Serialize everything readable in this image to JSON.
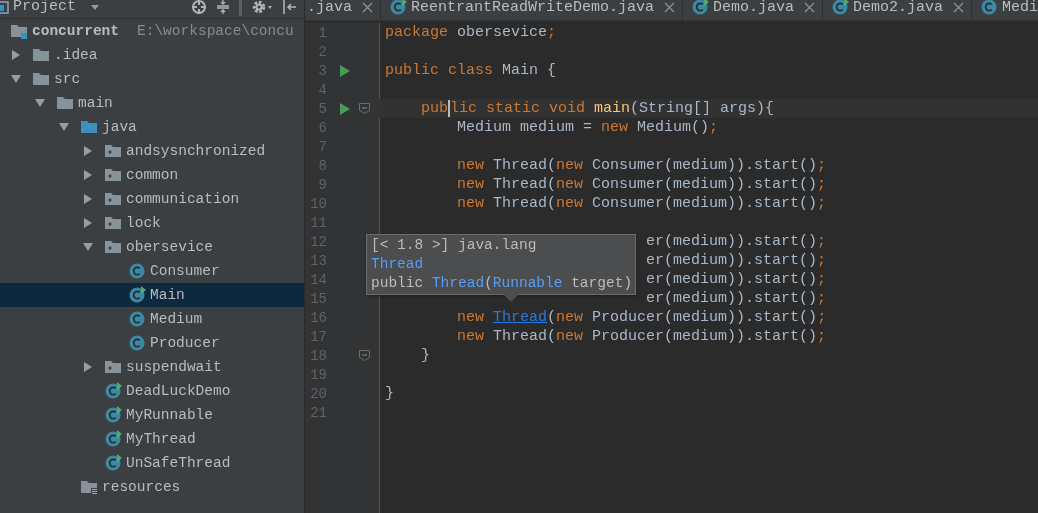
{
  "project_panel": {
    "title": "Project",
    "tree": [
      {
        "name": "concurrent",
        "path": "E:\\workspace\\concu",
        "kind": "module",
        "selected": false,
        "children": [
          {
            "name": ".idea",
            "kind": "folder",
            "expanded": false,
            "selected": false
          },
          {
            "name": "src",
            "kind": "folder",
            "expanded": true,
            "selected": false,
            "children": [
              {
                "name": "main",
                "kind": "folder",
                "expanded": true,
                "selected": false,
                "children": [
                  {
                    "name": "java",
                    "kind": "source-root",
                    "expanded": true,
                    "selected": false,
                    "children": [
                      {
                        "name": "andsysnchronized",
                        "kind": "package",
                        "expanded": false,
                        "selected": false
                      },
                      {
                        "name": "common",
                        "kind": "package",
                        "expanded": false,
                        "selected": false
                      },
                      {
                        "name": "communication",
                        "kind": "package",
                        "expanded": false,
                        "selected": false
                      },
                      {
                        "name": "lock",
                        "kind": "package",
                        "expanded": false,
                        "selected": false
                      },
                      {
                        "name": "obersevice",
                        "kind": "package",
                        "expanded": true,
                        "selected": false,
                        "children": [
                          {
                            "name": "Consumer",
                            "kind": "class",
                            "selected": false
                          },
                          {
                            "name": "Main",
                            "kind": "main-class",
                            "selected": true
                          },
                          {
                            "name": "Medium",
                            "kind": "class",
                            "selected": false
                          },
                          {
                            "name": "Producer",
                            "kind": "class",
                            "selected": false
                          }
                        ]
                      },
                      {
                        "name": "suspendwait",
                        "kind": "package",
                        "expanded": false,
                        "selected": false
                      },
                      {
                        "name": "DeadLuckDemo",
                        "kind": "main-class",
                        "selected": false
                      },
                      {
                        "name": "MyRunnable",
                        "kind": "main-class",
                        "selected": false
                      },
                      {
                        "name": "MyThread",
                        "kind": "main-class",
                        "selected": false
                      },
                      {
                        "name": "UnSafeThread",
                        "kind": "main-class",
                        "selected": false
                      }
                    ]
                  },
                  {
                    "name": "resources",
                    "kind": "resources",
                    "selected": false
                  }
                ]
              }
            ]
          }
        ]
      }
    ]
  },
  "tabs": [
    {
      "label": ".java",
      "selected": false
    },
    {
      "label": "ReentrantReadWriteDemo.java",
      "kind": "main-class",
      "selected": false
    },
    {
      "label": "Demo.java",
      "kind": "main-class",
      "selected": false
    },
    {
      "label": "Demo2.java",
      "kind": "main-class",
      "selected": false
    },
    {
      "label": "Medi",
      "kind": "class",
      "selected": false
    }
  ],
  "editor": {
    "lines": [
      {
        "number": "1",
        "tokens": [
          {
            "text": "package",
            "kind": "keyword"
          },
          {
            "text": " obersevice",
            "kind": "plain"
          },
          {
            "text": ";",
            "kind": "keyword"
          }
        ]
      },
      {
        "number": "2"
      },
      {
        "number": "3",
        "runnable": true,
        "tokens": [
          {
            "text": "public class",
            "kind": "keyword"
          },
          {
            "text": " Main {",
            "kind": "plain"
          }
        ]
      },
      {
        "number": "4"
      },
      {
        "number": "5",
        "runnable": true,
        "fold": true,
        "current": true,
        "tokens": [
          {
            "text": "    pub",
            "kind": "keyword"
          },
          {
            "kind": "caret"
          },
          {
            "text": "lic static void",
            "kind": "keyword"
          },
          {
            "text": " main",
            "kind": "method"
          },
          {
            "text": "(String[] args){",
            "kind": "plain"
          }
        ]
      },
      {
        "number": "6",
        "tokens": [
          {
            "text": "        Medium medium = ",
            "kind": "plain"
          },
          {
            "text": "new",
            "kind": "keyword"
          },
          {
            "text": " Medium()",
            "kind": "plain"
          },
          {
            "text": ";",
            "kind": "keyword"
          }
        ]
      },
      {
        "number": "7"
      },
      {
        "number": "8",
        "tokens": [
          {
            "text": "        new",
            "kind": "keyword"
          },
          {
            "text": " Thread(",
            "kind": "plain"
          },
          {
            "text": "new",
            "kind": "keyword"
          },
          {
            "text": " Consumer(medium)).start()",
            "kind": "plain"
          },
          {
            "text": ";",
            "kind": "keyword"
          }
        ]
      },
      {
        "number": "9",
        "tokens": [
          {
            "text": "        new",
            "kind": "keyword"
          },
          {
            "text": " Thread(",
            "kind": "plain"
          },
          {
            "text": "new",
            "kind": "keyword"
          },
          {
            "text": " Consumer(medium)).start()",
            "kind": "plain"
          },
          {
            "text": ";",
            "kind": "keyword"
          }
        ]
      },
      {
        "number": "10",
        "tokens": [
          {
            "text": "        new",
            "kind": "keyword"
          },
          {
            "text": " Thread(",
            "kind": "plain"
          },
          {
            "text": "new",
            "kind": "keyword"
          },
          {
            "text": " Consumer(medium)).start()",
            "kind": "plain"
          },
          {
            "text": ";",
            "kind": "keyword"
          }
        ]
      },
      {
        "number": "11"
      },
      {
        "number": "12",
        "covered": true,
        "tokens": [
          {
            "text": "er(medium)).start()",
            "kind": "plain"
          },
          {
            "text": ";",
            "kind": "keyword"
          }
        ]
      },
      {
        "number": "13",
        "covered": true,
        "tokens": [
          {
            "text": "er(medium)).start()",
            "kind": "plain"
          },
          {
            "text": ";",
            "kind": "keyword"
          }
        ]
      },
      {
        "number": "14",
        "covered": true,
        "tokens": [
          {
            "text": "er(medium)).start()",
            "kind": "plain"
          },
          {
            "text": ";",
            "kind": "keyword"
          }
        ]
      },
      {
        "number": "15",
        "covered": true,
        "tokens": [
          {
            "text": "er(medium)).start()",
            "kind": "plain"
          },
          {
            "text": ";",
            "kind": "keyword"
          }
        ]
      },
      {
        "number": "16",
        "tokens": [
          {
            "text": "        new ",
            "kind": "keyword"
          },
          {
            "text": "Thread",
            "kind": "link"
          },
          {
            "text": "(",
            "kind": "plain"
          },
          {
            "text": "new",
            "kind": "keyword"
          },
          {
            "text": " Producer(medium)).start()",
            "kind": "plain"
          },
          {
            "text": ";",
            "kind": "keyword"
          }
        ]
      },
      {
        "number": "17",
        "tokens": [
          {
            "text": "        new",
            "kind": "keyword"
          },
          {
            "text": " Thread(",
            "kind": "plain"
          },
          {
            "text": "new",
            "kind": "keyword"
          },
          {
            "text": " Producer(medium)).start()",
            "kind": "plain"
          },
          {
            "text": ";",
            "kind": "keyword"
          }
        ]
      },
      {
        "number": "18",
        "fold": true,
        "tokens": [
          {
            "text": "    }",
            "kind": "plain"
          }
        ]
      },
      {
        "number": "19"
      },
      {
        "number": "20",
        "tokens": [
          {
            "text": "}",
            "kind": "plain"
          }
        ]
      },
      {
        "number": "21"
      }
    ],
    "tooltip": {
      "lines": [
        [
          {
            "text": "[< 1.8 >] java.lang",
            "kind": "plain"
          }
        ],
        [
          {
            "text": "Thread",
            "kind": "link"
          }
        ],
        [
          {
            "text": "public ",
            "kind": "plain"
          },
          {
            "text": "Thread",
            "kind": "link"
          },
          {
            "text": "(",
            "kind": "plain"
          },
          {
            "text": "Runnable",
            "kind": "link"
          },
          {
            "text": " target)",
            "kind": "plain"
          }
        ]
      ]
    }
  }
}
